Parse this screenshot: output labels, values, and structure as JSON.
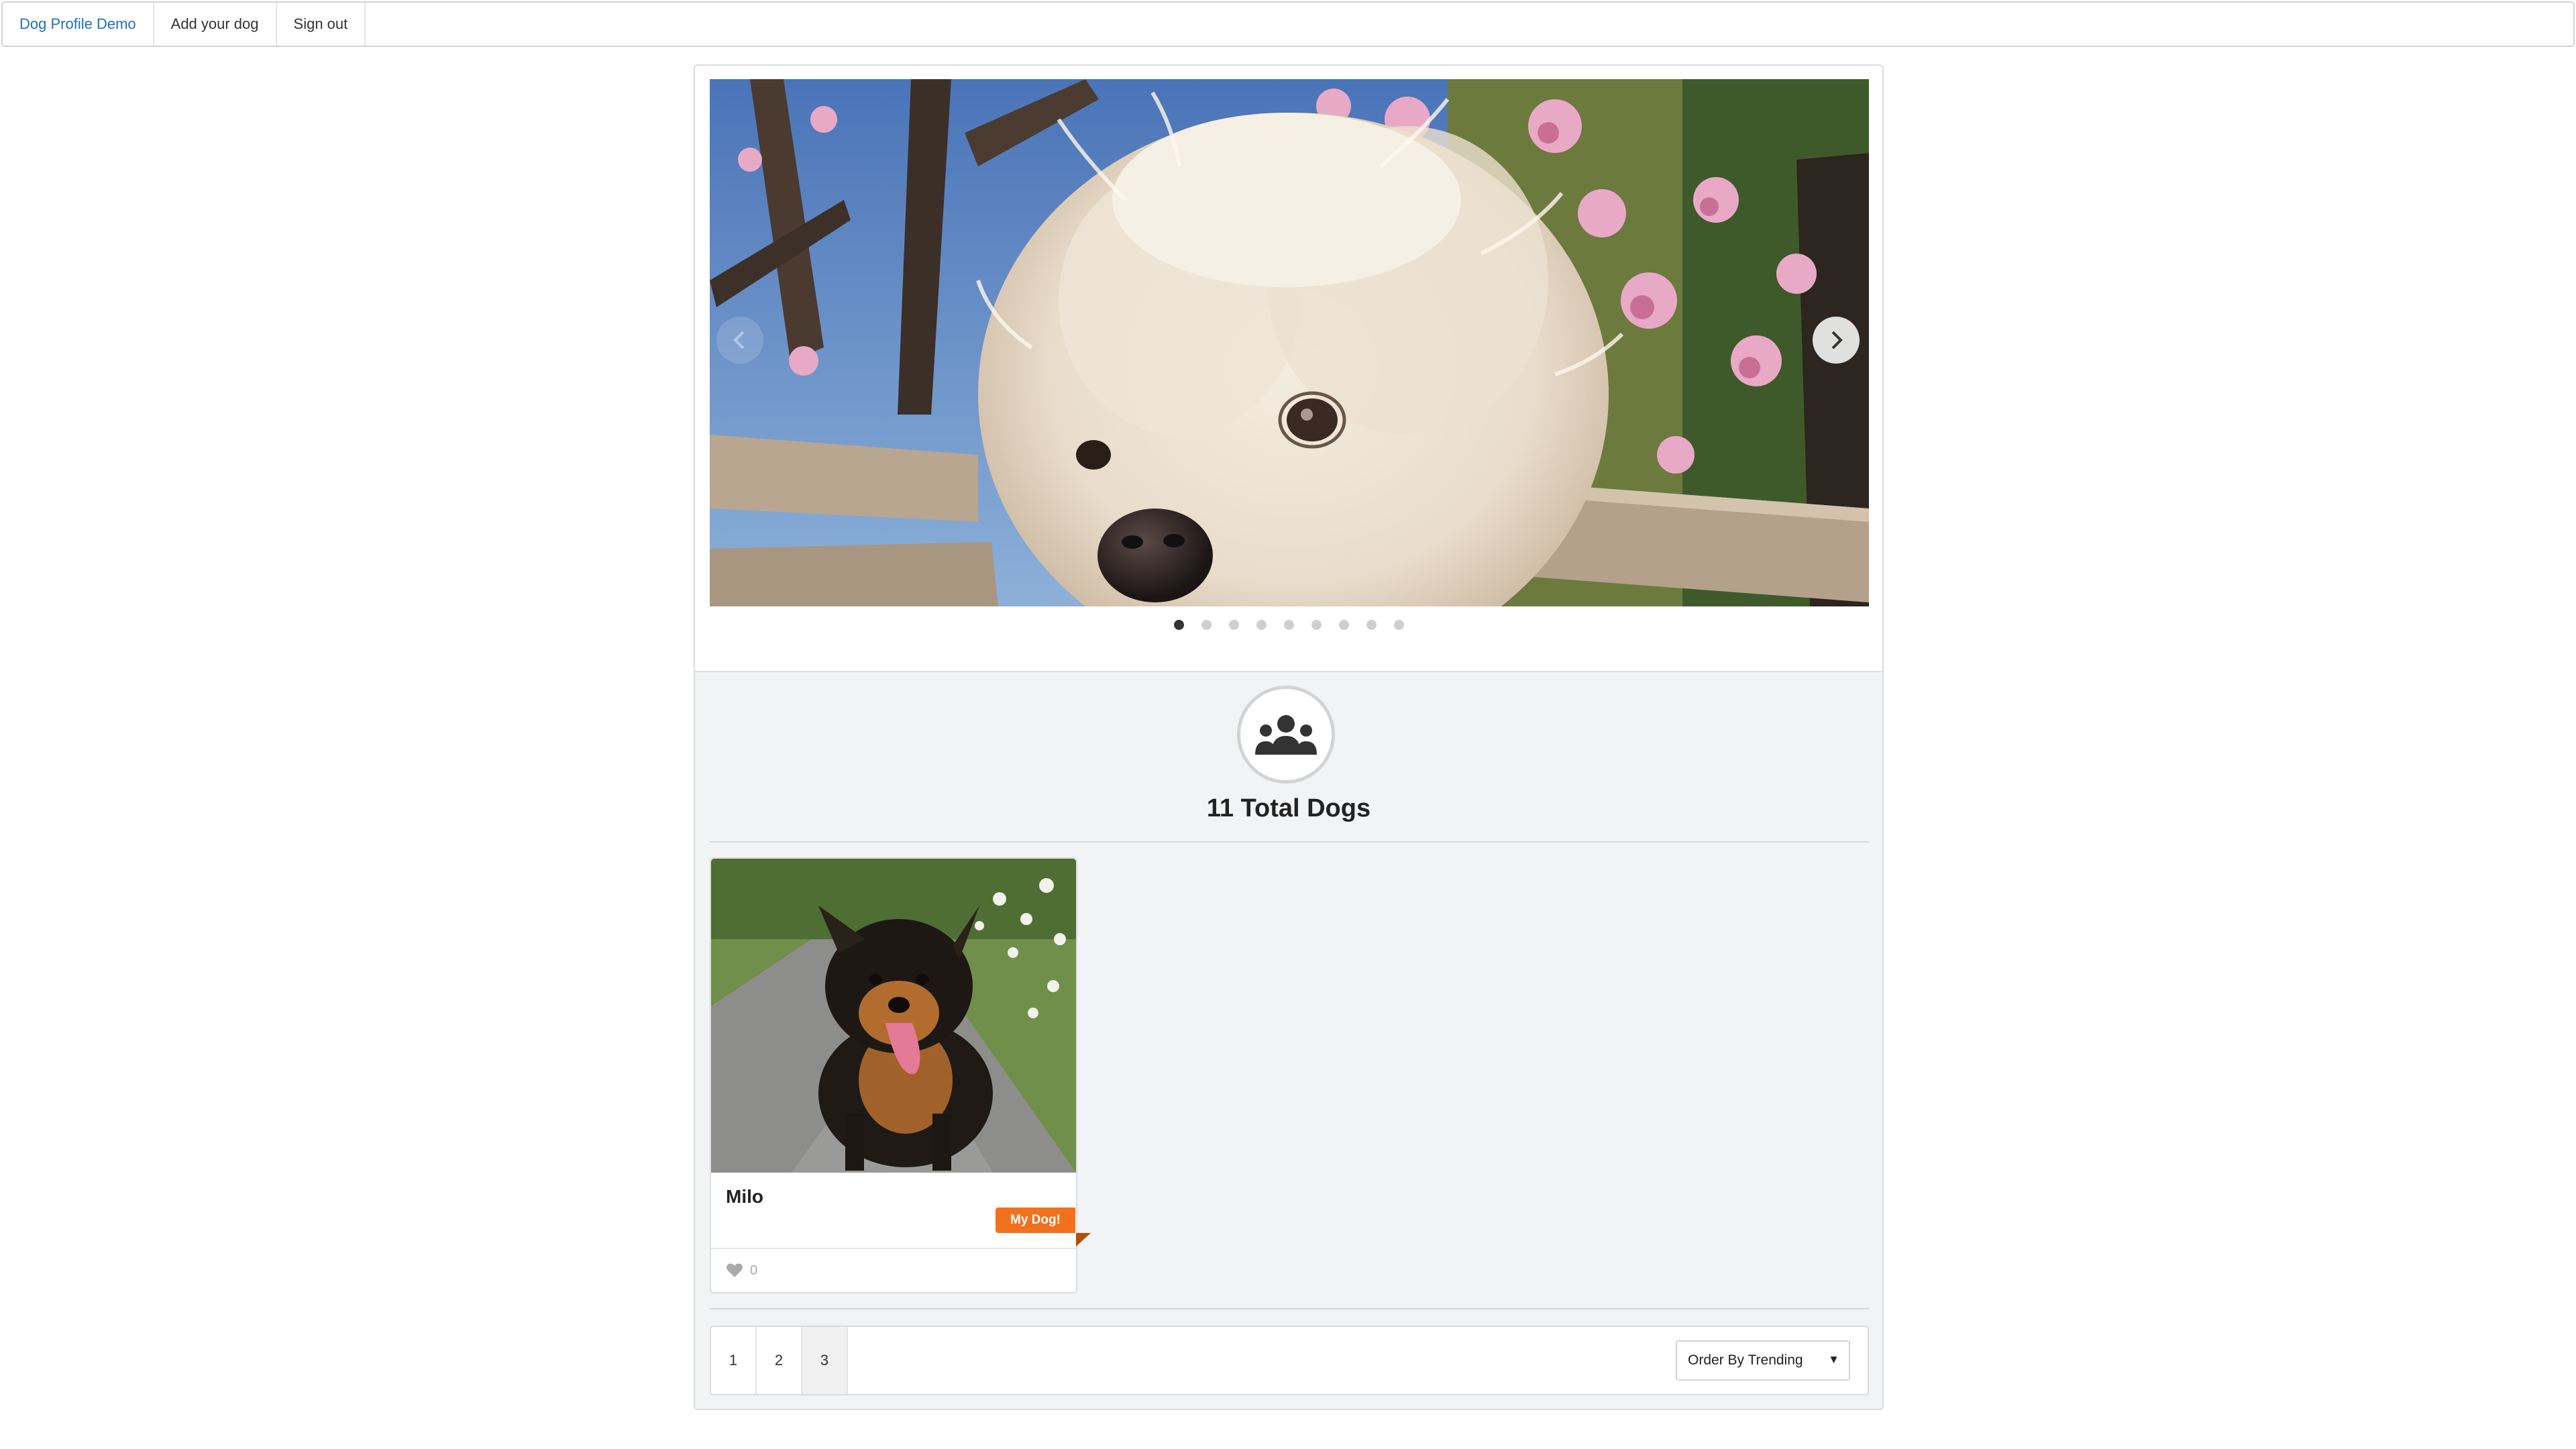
{
  "nav": {
    "brand": "Dog Profile Demo",
    "add": "Add your dog",
    "signout": "Sign out"
  },
  "carousel": {
    "image_subject": "white fluffy dog among magnolia blossoms",
    "slide_count": 9,
    "active_index": 0
  },
  "stats": {
    "icon": "users-icon",
    "total_label": "11 Total Dogs"
  },
  "dogs": [
    {
      "name": "Milo",
      "badge": "My Dog!",
      "likes": "0"
    }
  ],
  "pagination": {
    "pages": [
      "1",
      "2",
      "3"
    ],
    "active_page": "3"
  },
  "sort": {
    "selected": "Order By Trending"
  },
  "colors": {
    "brand": "#1f6fc2",
    "badge": "#f2711c",
    "panel": "#f2f3f4"
  }
}
